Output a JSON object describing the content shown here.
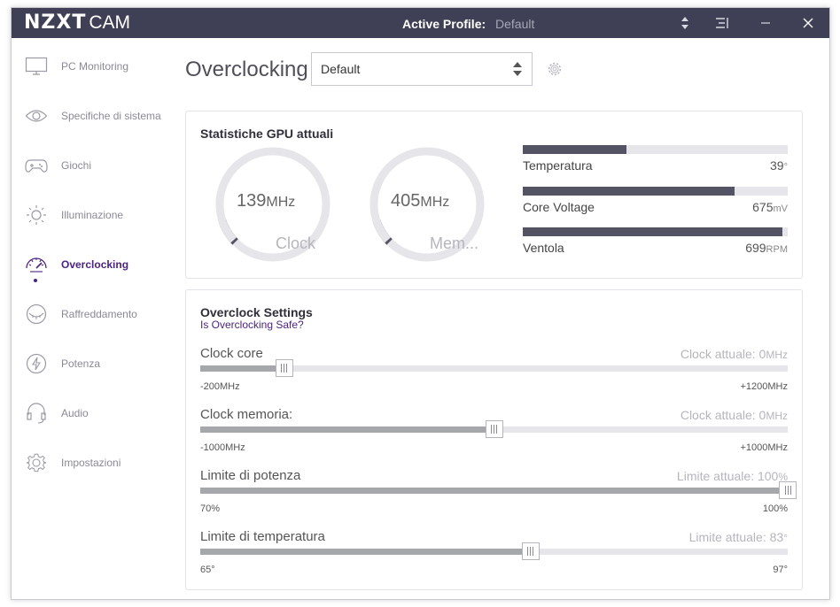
{
  "app": {
    "logo_main": "NZXT",
    "logo_sub": "CAM",
    "active_profile_label": "Active Profile:",
    "active_profile_value": "Default"
  },
  "colors": {
    "titlebar": "#3f4055",
    "accent": "#4b2480",
    "bar_fill": "#535363",
    "slider_fill": "#a6a7ab"
  },
  "sidebar": {
    "items": [
      {
        "label": "PC Monitoring",
        "icon": "monitor-icon",
        "active": false
      },
      {
        "label": "Specifiche di sistema",
        "icon": "eye-icon",
        "active": false
      },
      {
        "label": "Giochi",
        "icon": "gamepad-icon",
        "active": false
      },
      {
        "label": "Illuminazione",
        "icon": "sun-icon",
        "active": false
      },
      {
        "label": "Overclocking",
        "icon": "speedometer-icon",
        "active": true
      },
      {
        "label": "Raffreddamento",
        "icon": "cooling-icon",
        "active": false
      },
      {
        "label": "Potenza",
        "icon": "lightning-icon",
        "active": false
      },
      {
        "label": "Audio",
        "icon": "headset-icon",
        "active": false
      },
      {
        "label": "Impostazioni",
        "icon": "gear-icon",
        "active": false
      }
    ]
  },
  "header": {
    "title": "Overclocking",
    "profile_select": "Default"
  },
  "gpu_stats": {
    "title": "Statistiche GPU attuali",
    "gauges": [
      {
        "value": "139",
        "unit": "MHz",
        "label": "Clock",
        "fill": 0.1
      },
      {
        "value": "405",
        "unit": "MHz",
        "label": "Mem...",
        "fill": 0.1
      }
    ],
    "bars": [
      {
        "label": "Temperatura",
        "value": "39",
        "unit": "°",
        "fill": 0.39
      },
      {
        "label": "Core Voltage",
        "value": "675",
        "unit": "mV",
        "fill": 0.8
      },
      {
        "label": "Ventola",
        "value": "699",
        "unit": "RPM",
        "fill": 0.98
      }
    ]
  },
  "oc_settings": {
    "title": "Overclock Settings",
    "link": "Is Overclocking Safe?",
    "sliders": [
      {
        "name": "Clock core",
        "current_label": "Clock attuale: 0",
        "current_unit": "MHz",
        "min": "-200MHz",
        "max": "+1200MHz",
        "position": 0.143
      },
      {
        "name": "Clock memoria:",
        "current_label": "Clock attuale: 0",
        "current_unit": "MHz",
        "min": "-1000MHz",
        "max": "+1000MHz",
        "position": 0.5
      },
      {
        "name": "Limite di potenza",
        "current_label": "Limite attuale: 100",
        "current_unit": "%",
        "min": "70%",
        "max": "100%",
        "position": 1.0
      },
      {
        "name": "Limite di temperatura",
        "current_label": "Limite attuale: 83",
        "current_unit": "°",
        "min": "65°",
        "max": "97°",
        "position": 0.5625
      }
    ]
  }
}
